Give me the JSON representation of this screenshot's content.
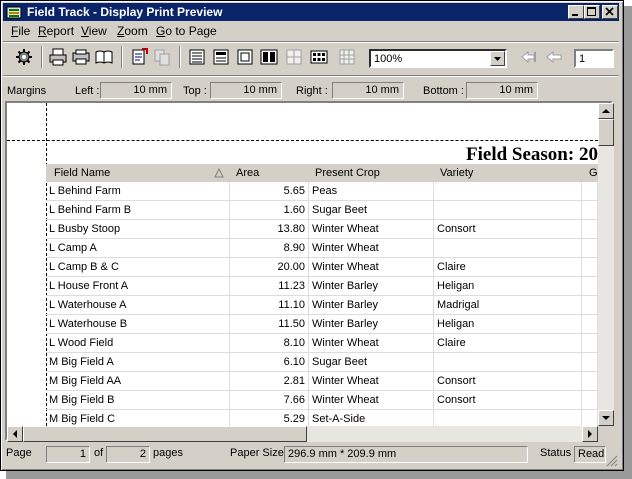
{
  "window": {
    "title": "Field Track - Display Print Preview"
  },
  "menu": {
    "items": [
      "File",
      "Report",
      "View",
      "Zoom",
      "Go to Page"
    ],
    "mnemonics": [
      "F",
      "R",
      "V",
      "Z",
      "G"
    ]
  },
  "toolbar": {
    "zoom_value": "100%",
    "page_number": "1"
  },
  "margins": {
    "label": "Margins",
    "left_label": "Left :",
    "left_value": "10 mm",
    "top_label": "Top :",
    "top_value": "10 mm",
    "right_label": "Right :",
    "right_value": "10 mm",
    "bottom_label": "Bottom :",
    "bottom_value": "10 mm"
  },
  "report": {
    "heading": "Field Season: 20",
    "columns": [
      "Field Name",
      "Area",
      "Present Crop",
      "Variety",
      "G"
    ],
    "rows": [
      [
        "L Behind Farm",
        "5.65",
        "Peas",
        ""
      ],
      [
        "L Behind Farm B",
        "1.60",
        "Sugar Beet",
        ""
      ],
      [
        "L Busby Stoop",
        "13.80",
        "Winter Wheat",
        "Consort"
      ],
      [
        "L Camp A",
        "8.90",
        "Winter Wheat",
        ""
      ],
      [
        "L Camp B & C",
        "20.00",
        "Winter Wheat",
        "Claire"
      ],
      [
        "L House Front A",
        "11.23",
        "Winter Barley",
        "Heligan"
      ],
      [
        "L Waterhouse A",
        "11.10",
        "Winter Barley",
        "Madrigal"
      ],
      [
        "L Waterhouse B",
        "11.50",
        "Winter Barley",
        "Heligan"
      ],
      [
        "L Wood Field",
        "8.10",
        "Winter Wheat",
        "Claire"
      ],
      [
        "M Big Field A",
        "6.10",
        "Sugar Beet",
        ""
      ],
      [
        "M Big Field AA",
        "2.81",
        "Winter Wheat",
        "Consort"
      ],
      [
        "M Big Field B",
        "7.66",
        "Winter Wheat",
        "Consort"
      ],
      [
        "M Big Field C",
        "5.29",
        "Set-A-Side",
        ""
      ]
    ]
  },
  "statusbar": {
    "page_label": "Page",
    "page_value": "1",
    "of_label": "of",
    "pages_value": "2",
    "pages_label": "pages",
    "paper_label": "Paper Size",
    "paper_value": "296.9 mm * 209.9 mm",
    "status_label": "Status",
    "status_value": "Read"
  },
  "colors": {
    "titlebar": "#0a246a",
    "face": "#d4d0c8"
  }
}
